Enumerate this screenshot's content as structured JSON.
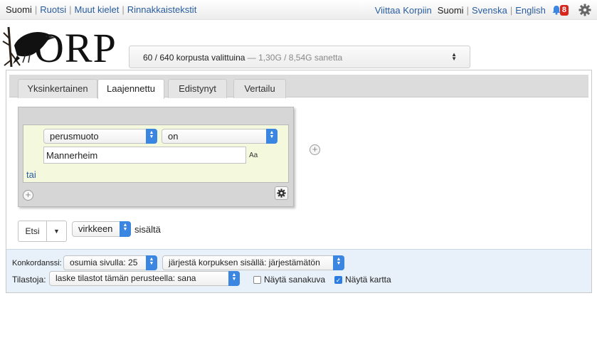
{
  "nav": {
    "left": [
      "Suomi",
      "Ruotsi",
      "Muut kielet",
      "Rinnakkaistekstit"
    ],
    "viittaa": "Viittaa Korpiin",
    "languages": [
      "Suomi",
      "Svenska",
      "English"
    ],
    "notification_count": "8",
    "icons": [
      "bell-icon",
      "gear-icon"
    ]
  },
  "logo": {
    "text": "ORP"
  },
  "corpus_selector": {
    "selected": "60 / 640 korpusta valittuina",
    "sizes": " — 1,30G / 8,54G sanetta"
  },
  "tabs": [
    "Yksinkertainen",
    "Laajennettu",
    "Edistynyt",
    "Vertailu"
  ],
  "active_tab": "Laajennettu",
  "query": {
    "attribute": "perusmuoto",
    "operator": "on",
    "value": "Mannerheim",
    "case_toggle": "Aa",
    "or_label": "tai"
  },
  "search": {
    "button": "Etsi",
    "within_select": "virkkeen",
    "within_suffix": "sisältä"
  },
  "options": {
    "concordance_label": "Konkordanssi:",
    "hits_per_page": "osumia sivulla: 25",
    "sort": "järjestä korpuksen sisällä: järjestämätön",
    "stats_label": "Tilastoja:",
    "stats_by": "laske tilastot tämän perusteella: sana",
    "show_wordpic": "Näytä sanakuva",
    "show_map": "Näytä kartta",
    "wordpic_checked": false,
    "map_checked": true
  },
  "colors": {
    "link": "#2a5d9f",
    "select_accent": "#3a86e0",
    "badge": "#d9261c",
    "query_bg": "#f4f9dd",
    "options_bg": "#e8f0fa"
  }
}
